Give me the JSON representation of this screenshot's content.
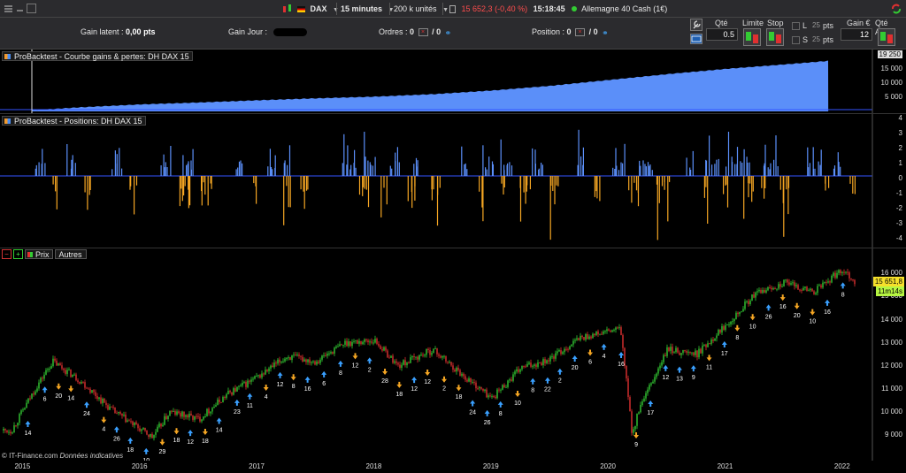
{
  "toolbar": {
    "instrument": "DAX",
    "timeframe": "15 minutes",
    "units": "200 k unités",
    "price": "15 652,3",
    "change": "(-0,40 %)",
    "time": "15:18:45",
    "product": "Allemagne 40 Cash (1€)"
  },
  "infobar": {
    "gain_latent_label": "Gain latent :",
    "gain_latent_value": "0,00 pts",
    "gain_jour_label": "Gain Jour :",
    "ordres_label": "Ordres :",
    "ordres_a": "0",
    "ordres_b": "/ 0",
    "position_label": "Position :",
    "position_a": "0",
    "position_b": "/ 0",
    "qte_label": "Qté",
    "qte_value": "0.5",
    "limite_label": "Limite",
    "stop_label": "Stop",
    "l_label": "L",
    "s_label": "S",
    "l_value": "25",
    "s_value": "25",
    "pts_label": "pts",
    "gain_label": "Gain €",
    "gain_value": "12",
    "qte_auto_label": "Qté Auto"
  },
  "panels": {
    "equity_title": "ProBacktest - Courbe gains & pertes: DH DAX 15",
    "positions_title": "ProBacktest - Positions: DH DAX 15",
    "price_tab_prix": "Prix",
    "price_tab_autres": "Autres"
  },
  "equity_axis": [
    "19 250",
    "15 000",
    "10 000",
    "5 000"
  ],
  "positions_axis": [
    "4",
    "3",
    "2",
    "1",
    "0",
    "-1",
    "-2",
    "-3",
    "-4"
  ],
  "price_axis": [
    "16 000",
    "15 000",
    "14 000",
    "13 000",
    "12 000",
    "11 000",
    "10 000",
    "9 000"
  ],
  "price_tags": {
    "last": "15 651,8",
    "timer": "11m14s"
  },
  "x_axis": [
    "2015",
    "2016",
    "2017",
    "2018",
    "2019",
    "2020",
    "2021",
    "2022"
  ],
  "credit": {
    "site": "© IT-Finance.com",
    "note": "Données indicatives"
  },
  "colors": {
    "equity": "#5b8ff9",
    "long": "#5b8ff9",
    "short": "#f5a623",
    "up": "#33cc33",
    "down": "#e03030",
    "last_tag": "#f5e02b",
    "timer_tag": "#b6f542"
  },
  "chart_data": [
    {
      "type": "area",
      "title": "ProBacktest - Courbe gains & pertes: DH DAX 15",
      "x": [
        2014.9,
        2015.5,
        2016.0,
        2016.5,
        2017.0,
        2017.5,
        2018.0,
        2018.5,
        2019.0,
        2019.5,
        2020.0,
        2020.5,
        2021.0,
        2021.5,
        2022.0,
        2022.1
      ],
      "y": [
        0,
        1500,
        2500,
        3200,
        4000,
        4700,
        5300,
        6200,
        7500,
        9200,
        11300,
        13400,
        15300,
        16900,
        18600,
        19250
      ],
      "ylim": [
        0,
        21000
      ]
    },
    {
      "type": "bar",
      "title": "ProBacktest - Positions: DH DAX 15",
      "ylim": [
        -4.5,
        4.5
      ],
      "series": [
        {
          "name": "long",
          "values": [
            1,
            1,
            2,
            1,
            3,
            1,
            2,
            1,
            1,
            2,
            1,
            1,
            3,
            2,
            1,
            2,
            1,
            1,
            2,
            1,
            1,
            1,
            2,
            3,
            1,
            1,
            2,
            1,
            1,
            2,
            1,
            1,
            1,
            2,
            1,
            1,
            2,
            1,
            1,
            3,
            1,
            1
          ]
        },
        {
          "name": "short",
          "values": [
            -1,
            -2,
            -3,
            -1,
            -4,
            -2,
            -1,
            -2,
            -1,
            -3,
            -1,
            -2,
            -1,
            -4,
            -2,
            -1,
            -1,
            -2,
            -3,
            -1,
            -2,
            -1,
            -3,
            -2,
            -1,
            -2,
            -1,
            -1,
            -2,
            -4,
            -1,
            -2,
            -3,
            -1,
            -1,
            -2,
            -1,
            -2,
            -3,
            -1,
            -2,
            -1
          ]
        }
      ]
    },
    {
      "type": "line",
      "title": "Prix",
      "x": [
        2014.9,
        2015.1,
        2015.25,
        2015.5,
        2015.75,
        2016.1,
        2016.25,
        2016.5,
        2016.75,
        2017.0,
        2017.25,
        2017.5,
        2017.75,
        2018.0,
        2018.2,
        2018.5,
        2018.75,
        2019.0,
        2019.25,
        2019.5,
        2019.75,
        2020.1,
        2020.2,
        2020.25,
        2020.5,
        2020.75,
        2021.0,
        2021.25,
        2021.5,
        2021.75,
        2022.0,
        2022.1
      ],
      "y": [
        9200,
        11000,
        12200,
        11300,
        10100,
        8900,
        10000,
        9700,
        10800,
        11500,
        12400,
        12200,
        13000,
        13100,
        12000,
        12700,
        11600,
        10600,
        11900,
        12300,
        13200,
        13600,
        9000,
        10000,
        12700,
        12500,
        13800,
        15100,
        15600,
        15200,
        16200,
        15650
      ],
      "ylim": [
        8200,
        16700
      ],
      "markers": [
        "14",
        "6",
        "20",
        "14",
        "24",
        "4",
        "26",
        "18",
        "10",
        "29",
        "18",
        "12",
        "18",
        "14",
        "23",
        "11",
        "4",
        "12",
        "8",
        "16",
        "6",
        "8",
        "12",
        "2",
        "28",
        "18",
        "12",
        "12",
        "2",
        "18",
        "24",
        "26",
        "8",
        "10",
        "8",
        "22",
        "2",
        "20",
        "6",
        "4",
        "16",
        "9",
        "17",
        "12",
        "13",
        "9",
        "11",
        "17",
        "8",
        "10",
        "26",
        "16",
        "20",
        "10",
        "16",
        "8"
      ]
    }
  ]
}
